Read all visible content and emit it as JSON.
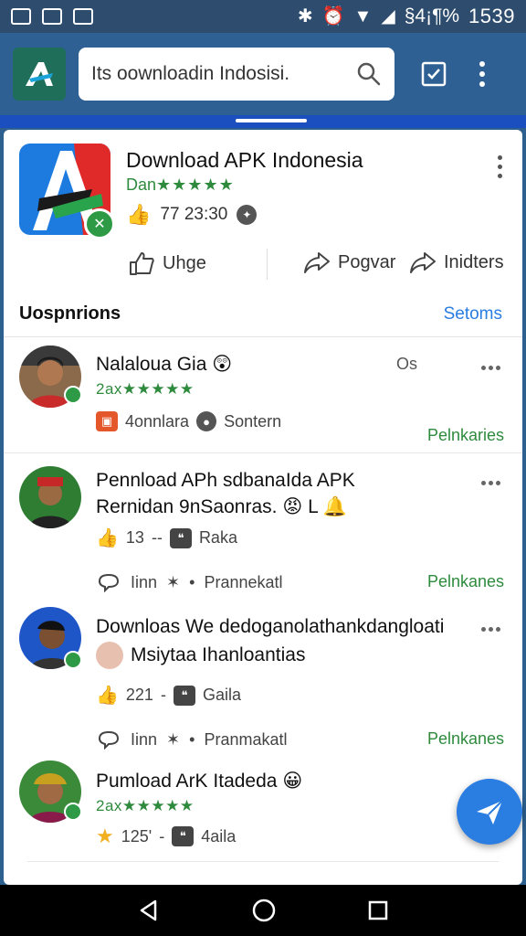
{
  "status_bar": {
    "time": "1539",
    "battery_text": "§4¡¶%"
  },
  "app_bar": {
    "search_text": "Its oownloadin Indosisi."
  },
  "app": {
    "title": "Download APK Indonesia",
    "subtitle": "Dan",
    "stars": "★★★★★",
    "time": "77 23:30",
    "actions": {
      "like": "Uhge",
      "share": "Pogvar",
      "more": "Inidters"
    }
  },
  "section": {
    "title": "Uospnrions",
    "link": "Setoms"
  },
  "comments": [
    {
      "name": "Nalaloua Gia",
      "rating": "2ax",
      "stars": "★★★★★",
      "meta_a": "4onnlara",
      "meta_b": "Sontern",
      "link": "Pelnkaries",
      "tag": "Os"
    },
    {
      "line1": "Pennload APh sdbanaIda APK",
      "line2": "Rernidan 9nSaonras.",
      "line2_suffix": "L",
      "count": "13",
      "sep": "--",
      "label": "Raka",
      "reply": "Iinn",
      "reply_sep": "•",
      "reply_label": "Prannekatl",
      "link": "Pelnkanes"
    },
    {
      "line1": "Downloas We dedoganolathankdangloati",
      "line2": "Msiytaa Ihanloantias",
      "count": "221",
      "sep": "-",
      "label": "Gaila",
      "reply": "Iinn",
      "reply_sep": "•",
      "reply_label": "Pranmakatl",
      "link": "Pelnkanes"
    },
    {
      "name": "Pumload ArK Itadeda",
      "rating": "2ax",
      "stars": "★★★★★",
      "count": "125'",
      "sep": "-",
      "label": "4aila"
    }
  ],
  "colors": {
    "app_bar": "#2e6093",
    "accent": "#1b4fbf",
    "green": "#2e8b3e",
    "link_blue": "#2a7de1",
    "fab": "#2a7de1"
  }
}
